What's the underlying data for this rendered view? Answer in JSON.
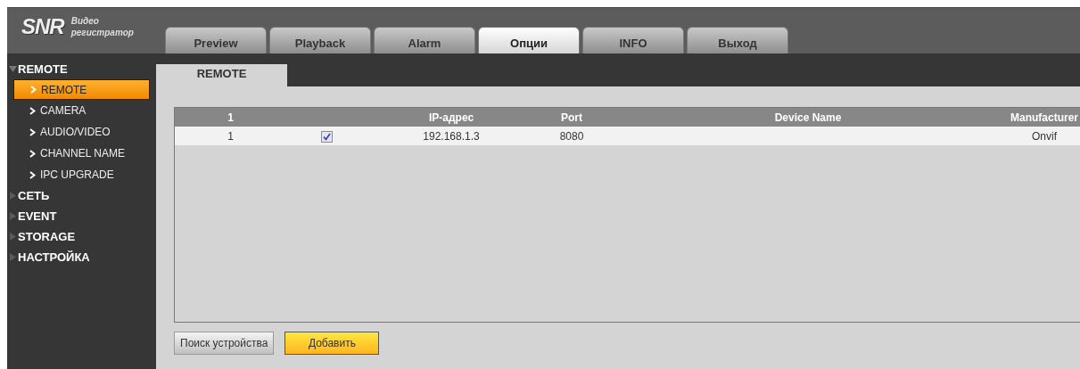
{
  "header": {
    "logo": "SNR",
    "logo_caption": "Видео регистратор"
  },
  "tabs": [
    {
      "label": "Preview",
      "selected": false
    },
    {
      "label": "Playback",
      "selected": false
    },
    {
      "label": "Alarm",
      "selected": false
    },
    {
      "label": "Опции",
      "selected": true
    },
    {
      "label": "INFO",
      "selected": false
    },
    {
      "label": "Выход",
      "selected": false
    }
  ],
  "sidebar": {
    "items": [
      {
        "label": "REMOTE",
        "expanded": true,
        "children": [
          {
            "label": "REMOTE",
            "selected": true
          },
          {
            "label": "CAMERA",
            "selected": false
          },
          {
            "label": "AUDIO/VIDEO",
            "selected": false
          },
          {
            "label": "CHANNEL NAME",
            "selected": false
          },
          {
            "label": "IPC UPGRADE",
            "selected": false
          }
        ]
      },
      {
        "label": "СЕТЬ",
        "expanded": false
      },
      {
        "label": "EVENT",
        "expanded": false
      },
      {
        "label": "STORAGE",
        "expanded": false
      },
      {
        "label": "НАСТРОЙКА",
        "expanded": false
      }
    ]
  },
  "subtabs": [
    {
      "label": "REMOTE",
      "selected": true
    }
  ],
  "table": {
    "columns": [
      "1",
      "",
      "IP-адрес",
      "Port",
      "Device Name",
      "Manufacturer"
    ],
    "rows": [
      {
        "number": "1",
        "checked": true,
        "ip": "192.168.1.3",
        "port": "8080",
        "device_name": "",
        "manufacturer": "Onvif"
      }
    ]
  },
  "buttons": [
    {
      "label": "Поиск устройства",
      "kind": "plain"
    },
    {
      "label": "Добавить",
      "kind": "primary"
    }
  ]
}
